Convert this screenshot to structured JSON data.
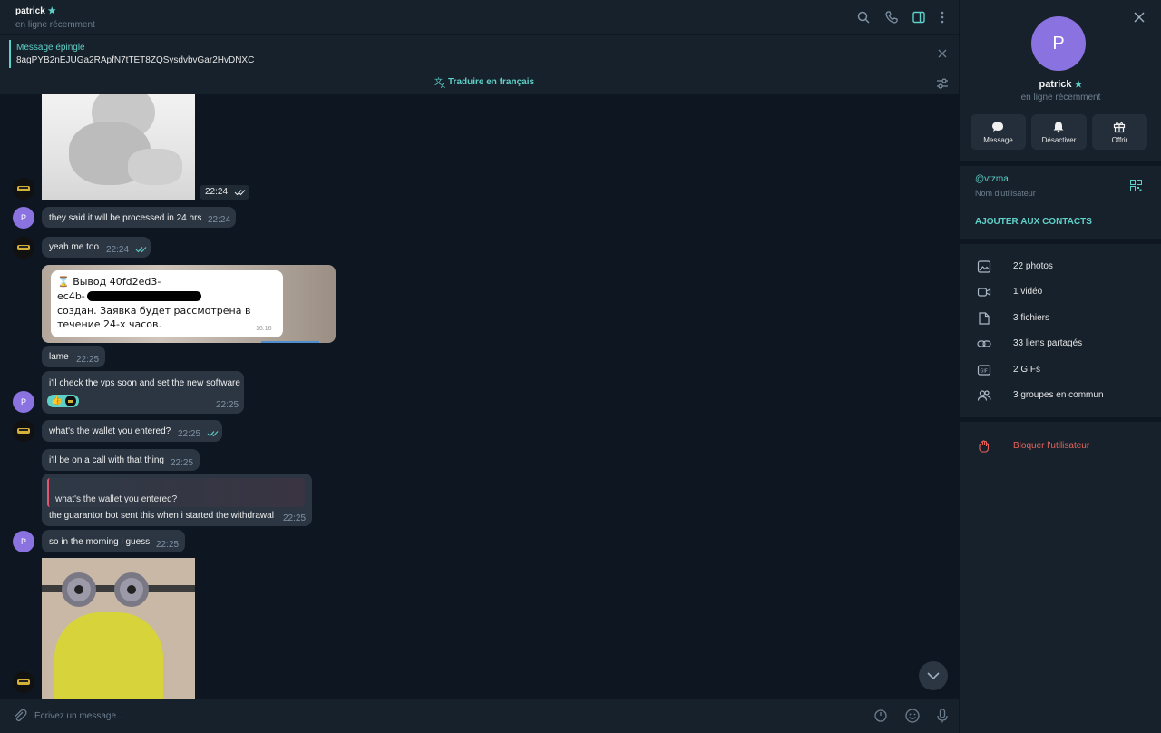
{
  "header": {
    "name": "patrick",
    "status": "en ligne récemment",
    "icons": [
      "search-icon",
      "phone-icon",
      "sidebar-icon",
      "more-icon"
    ]
  },
  "pinned": {
    "title": "Message épinglé",
    "text": "8agPYB2nEJUGa2RApfN7tTET8ZQSysdvbvGar2HvDNXC"
  },
  "translate": {
    "label": "Traduire en français"
  },
  "messages": [
    {
      "id": "m0",
      "kind": "image",
      "desc": "white 3D figure sitting",
      "time": "22:24",
      "from": "me",
      "read": true
    },
    {
      "id": "m1",
      "kind": "text",
      "from": "patrick",
      "text": "they said it will be processed in 24 hrs",
      "time": "22:24"
    },
    {
      "id": "m2",
      "kind": "text",
      "from": "me",
      "text": "yeah me too",
      "time": "22:24",
      "read": true
    },
    {
      "id": "m3",
      "kind": "screenshot",
      "from": "me",
      "lines": [
        "⌛ Вывод 40fd2ed3-",
        "ec4b-                                   0164 успешно",
        "создан. Заявка будет рассмотрена в",
        "течение 24-х часов."
      ],
      "inner_time": "16:16"
    },
    {
      "id": "m4",
      "kind": "text",
      "from": "patrick",
      "text": "lame",
      "time": "22:25"
    },
    {
      "id": "m5",
      "kind": "text",
      "from": "patrick",
      "text": "i'll check the vps soon and set the new software",
      "time": "22:25",
      "reaction": "👍"
    },
    {
      "id": "m6",
      "kind": "text",
      "from": "me",
      "text": "what's the wallet you entered?",
      "time": "22:25",
      "read": true
    },
    {
      "id": "m7",
      "kind": "text",
      "from": "patrick",
      "text": "i'll be on a call with that thing",
      "time": "22:25"
    },
    {
      "id": "m8",
      "kind": "reply",
      "from": "patrick",
      "quote": "what's the wallet you entered?",
      "text": "the guarantor bot sent this when i started the withdrawal",
      "time": "22:25"
    },
    {
      "id": "m9",
      "kind": "text",
      "from": "patrick",
      "text": "so in the morning i guess",
      "time": "22:25"
    },
    {
      "id": "m10",
      "kind": "image",
      "from": "me",
      "desc": "minion sticker"
    }
  ],
  "composer": {
    "placeholder": "Écrivez un message..."
  },
  "panel": {
    "avatar_letter": "P",
    "name": "patrick",
    "status": "en ligne récemment",
    "actions": [
      {
        "label": "Message",
        "icon": "message-icon"
      },
      {
        "label": "Désactiver",
        "icon": "bell-icon"
      },
      {
        "label": "Offrir",
        "icon": "gift-icon"
      }
    ],
    "username": "@vtzma",
    "username_label": "Nom d'utilisateur",
    "add_contact": "AJOUTER AUX CONTACTS",
    "media": [
      {
        "label": "22 photos",
        "icon": "photo-icon"
      },
      {
        "label": "1 vidéo",
        "icon": "video-icon"
      },
      {
        "label": "3 fichiers",
        "icon": "file-icon"
      },
      {
        "label": "33 liens partagés",
        "icon": "link-icon"
      },
      {
        "label": "2 GIFs",
        "icon": "gif-icon"
      },
      {
        "label": "3 groupes en commun",
        "icon": "groups-icon"
      }
    ],
    "block": "Bloquer l'utilisateur"
  },
  "colors": {
    "accent": "#5fd0c8",
    "danger": "#e8625b",
    "bubble": "#2b3642",
    "background": "#0e1621",
    "panel": "#17212b"
  }
}
